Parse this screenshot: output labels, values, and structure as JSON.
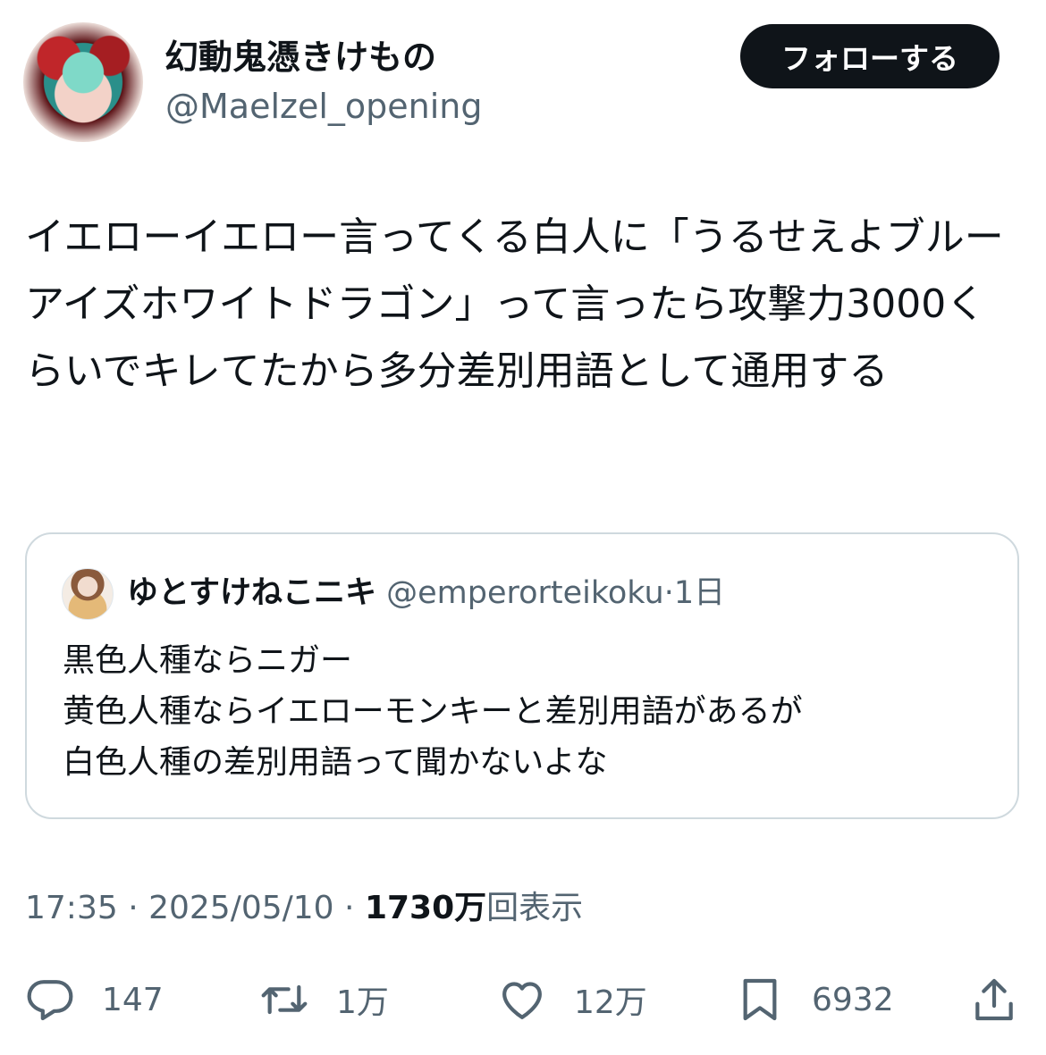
{
  "author": {
    "display_name": "幻動鬼憑きけもの",
    "handle": "@Maelzel_opening"
  },
  "follow_label": "フォローする",
  "tweet_text": "イエローイエロー言ってくる白人に「うるせえよブルーアイズホワイトドラゴン」って言ったら攻撃力3000くらいでキレてたから多分差別用語として通用する",
  "quote": {
    "name": "ゆとすけねこニキ",
    "handle": "@emperorteikoku",
    "separator": "·",
    "time": "1日",
    "text": "黒色人種ならニガー\n黄色人種ならイエローモンキーと差別用語があるが\n白色人種の差別用語って聞かないよな"
  },
  "meta": {
    "time": "17:35",
    "separator": " · ",
    "date": "2025/05/10",
    "views_count": "1730万",
    "views_label": "回表示"
  },
  "actions": {
    "reply": {
      "icon": "reply-icon",
      "count": "147"
    },
    "retweet": {
      "icon": "retweet-icon",
      "count": "1万"
    },
    "like": {
      "icon": "heart-icon",
      "count": "12万"
    },
    "bookmark": {
      "icon": "bookmark-icon",
      "count": "6932"
    },
    "share": {
      "icon": "share-icon"
    }
  }
}
